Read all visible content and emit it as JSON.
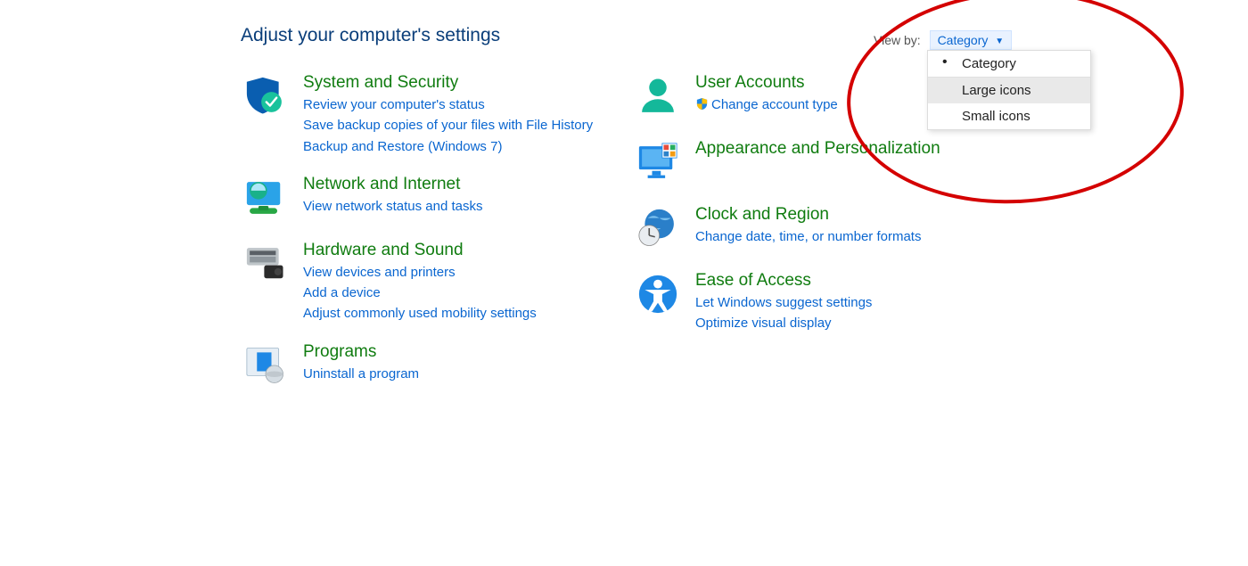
{
  "title": "Adjust your computer's settings",
  "viewby": {
    "label": "View by:",
    "current": "Category",
    "options": {
      "category": "Category",
      "large": "Large icons",
      "small": "Small icons"
    }
  },
  "left": {
    "system": {
      "title": "System and Security",
      "links": {
        "l0": "Review your computer's status",
        "l1": "Save backup copies of your files with File History",
        "l2": "Backup and Restore (Windows 7)"
      }
    },
    "network": {
      "title": "Network and Internet",
      "links": {
        "l0": "View network status and tasks"
      }
    },
    "hardware": {
      "title": "Hardware and Sound",
      "links": {
        "l0": "View devices and printers",
        "l1": "Add a device",
        "l2": "Adjust commonly used mobility settings"
      }
    },
    "programs": {
      "title": "Programs",
      "links": {
        "l0": "Uninstall a program"
      }
    }
  },
  "right": {
    "users": {
      "title": "User Accounts",
      "links": {
        "l0": "Change account type"
      }
    },
    "appearance": {
      "title": "Appearance and Personalization"
    },
    "clock": {
      "title": "Clock and Region",
      "links": {
        "l0": "Change date, time, or number formats"
      }
    },
    "ease": {
      "title": "Ease of Access",
      "links": {
        "l0": "Let Windows suggest settings",
        "l1": "Optimize visual display"
      }
    }
  }
}
